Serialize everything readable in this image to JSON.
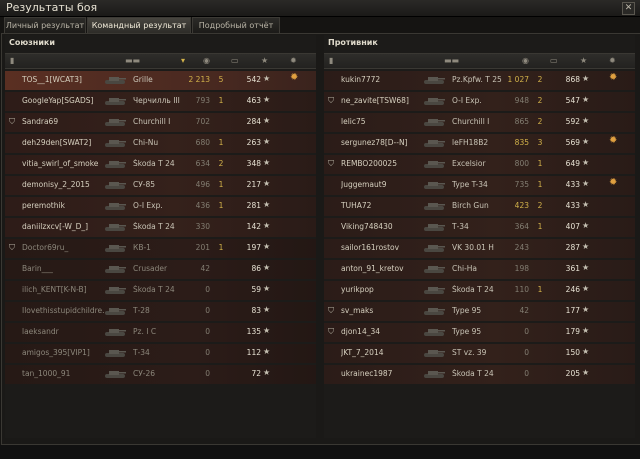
{
  "window": {
    "title": "Результаты боя",
    "close_glyph": "✕"
  },
  "tabs": [
    {
      "label": "Личный результат",
      "active": false
    },
    {
      "label": "Командный результат",
      "active": true
    },
    {
      "label": "Подробный отчёт",
      "active": false
    }
  ],
  "allies": {
    "title": "Союзники",
    "players": [
      {
        "name": "TOS__1[WCAT3]",
        "tank": "Grille",
        "damage": "2 213",
        "kills": "5",
        "xp": "542",
        "medal": true,
        "own": true
      },
      {
        "name": "GoogleYap[SGADS]",
        "tank": "Черчилль III",
        "damage": "793",
        "kills": "1",
        "xp": "463"
      },
      {
        "name": "Sandra69",
        "tank": "Churchill I",
        "damage": "702",
        "kills": "",
        "xp": "284",
        "clan_icon": true
      },
      {
        "name": "deh29den[SWAT2]",
        "tank": "Chi-Nu",
        "damage": "680",
        "kills": "1",
        "xp": "263"
      },
      {
        "name": "vitia_swirl_of_smoke",
        "tank": "Škoda T 24",
        "damage": "634",
        "kills": "2",
        "xp": "348"
      },
      {
        "name": "demonisy_2_2015",
        "tank": "СУ-85",
        "damage": "496",
        "kills": "1",
        "xp": "217"
      },
      {
        "name": "peremothik",
        "tank": "O-I Exp.",
        "damage": "436",
        "kills": "1",
        "xp": "281"
      },
      {
        "name": "daniilzxcv[-W_D_]",
        "tank": "Škoda T 24",
        "damage": "330",
        "kills": "",
        "xp": "142"
      },
      {
        "name": "Doctor69ru_",
        "tank": "КВ-1",
        "damage": "201",
        "kills": "1",
        "xp": "197",
        "clan_icon": true,
        "dead": true
      },
      {
        "name": "Barin___",
        "tank": "Crusader",
        "damage": "42",
        "kills": "",
        "xp": "86",
        "dead": true
      },
      {
        "name": "ilich_KENT[K-N-B]",
        "tank": "Škoda T 24",
        "damage": "0",
        "kills": "",
        "xp": "59",
        "dead": true
      },
      {
        "name": "Ilovethisstupidchildre...",
        "tank": "Т-28",
        "damage": "0",
        "kills": "",
        "xp": "83",
        "dead": true
      },
      {
        "name": "laeksandr",
        "tank": "Pz. I C",
        "damage": "0",
        "kills": "",
        "xp": "135",
        "dead": true
      },
      {
        "name": "amigos_395[VIP1]",
        "tank": "Т-34",
        "damage": "0",
        "kills": "",
        "xp": "112",
        "dead": true
      },
      {
        "name": "tan_1000_91",
        "tank": "СУ-26",
        "damage": "0",
        "kills": "",
        "xp": "72",
        "dead": true
      }
    ]
  },
  "enemies": {
    "title": "Противник",
    "players": [
      {
        "name": "kukin7772",
        "tank": "Pz.Kpfw. T 25",
        "damage": "1 027",
        "kills": "2",
        "xp": "868",
        "medal": true
      },
      {
        "name": "ne_zavite[TSW68]",
        "tank": "O-I Exp.",
        "damage": "948",
        "kills": "2",
        "xp": "547",
        "clan_icon": true
      },
      {
        "name": "lelic75",
        "tank": "Churchill I",
        "damage": "865",
        "kills": "2",
        "xp": "592"
      },
      {
        "name": "sergunez78[D--N]",
        "tank": "leFH18B2",
        "damage": "835",
        "kills": "3",
        "xp": "569",
        "medal": true
      },
      {
        "name": "REMBO200025",
        "tank": "Excelsior",
        "damage": "800",
        "kills": "1",
        "xp": "649",
        "clan_icon": true
      },
      {
        "name": "Juggemaut9",
        "tank": "Type T-34",
        "damage": "735",
        "kills": "1",
        "xp": "433",
        "medal": true
      },
      {
        "name": "TUHA72",
        "tank": "Birch Gun",
        "damage": "423",
        "kills": "2",
        "xp": "433"
      },
      {
        "name": "Viking748430",
        "tank": "Т-34",
        "damage": "364",
        "kills": "1",
        "xp": "407"
      },
      {
        "name": "sailor161rostov",
        "tank": "VK 30.01 H",
        "damage": "243",
        "kills": "",
        "xp": "287"
      },
      {
        "name": "anton_91_kretov",
        "tank": "Chi-Ha",
        "damage": "198",
        "kills": "",
        "xp": "361"
      },
      {
        "name": "yurikpop",
        "tank": "Škoda T 24",
        "damage": "110",
        "kills": "1",
        "xp": "246"
      },
      {
        "name": "sv_maks",
        "tank": "Type 95",
        "damage": "42",
        "kills": "",
        "xp": "177",
        "clan_icon": true
      },
      {
        "name": "djon14_34",
        "tank": "Type 95",
        "damage": "0",
        "kills": "",
        "xp": "179",
        "clan_icon": true
      },
      {
        "name": "JKT_7_2014",
        "tank": "ST vz. 39",
        "damage": "0",
        "kills": "",
        "xp": "150"
      },
      {
        "name": "ukrainec1987",
        "tank": "Škoda T 24",
        "damage": "0",
        "kills": "",
        "xp": "205"
      }
    ]
  },
  "icons": {
    "star": "★",
    "medal": "✹",
    "clan": "⛉",
    "sort": "▾"
  },
  "colors": {
    "accent_gold": "#d2b24a",
    "row_red": "#35211b",
    "own_row": "#5a2f22"
  }
}
